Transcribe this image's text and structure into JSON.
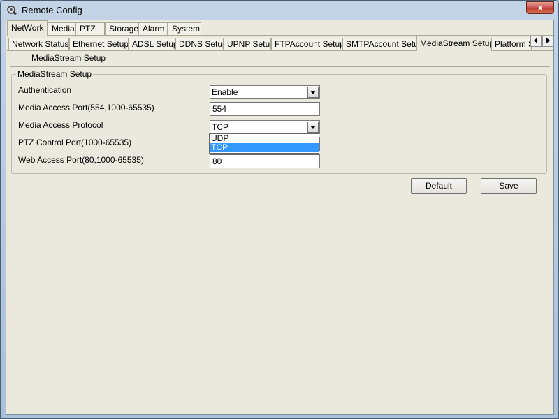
{
  "window": {
    "title": "Remote Config",
    "close_label": "x"
  },
  "main_tabs": [
    {
      "label": "NetWork"
    },
    {
      "label": "Media"
    },
    {
      "label": "PTZ"
    },
    {
      "label": "Storage"
    },
    {
      "label": "Alarm"
    },
    {
      "label": "System"
    }
  ],
  "sub_tabs": [
    {
      "label": "Network Status"
    },
    {
      "label": "Ethernet Setup"
    },
    {
      "label": "ADSL Setup"
    },
    {
      "label": "DDNS Setup"
    },
    {
      "label": "UPNP Setup"
    },
    {
      "label": "FTPAccount Setup"
    },
    {
      "label": "SMTPAccount Setup"
    },
    {
      "label": "MediaStream Setup"
    },
    {
      "label": "Platform S"
    }
  ],
  "page": {
    "heading": "MediaStream Setup",
    "group_title": "MediaStream Setup"
  },
  "fields": {
    "authentication": {
      "label": "Authentication",
      "value": "Enable"
    },
    "media_port": {
      "label": "Media Access Port(554,1000-65535)",
      "value": "554"
    },
    "protocol": {
      "label": "Media Access Protocol",
      "value": "TCP",
      "options": [
        "UDP",
        "TCP"
      ]
    },
    "ptz_port": {
      "label": "PTZ Control Port(1000-65535)",
      "value": ""
    },
    "web_port": {
      "label": "Web Access Port(80,1000-65535)",
      "value": "80"
    }
  },
  "buttons": {
    "default_label": "Default",
    "save_label": "Save"
  }
}
